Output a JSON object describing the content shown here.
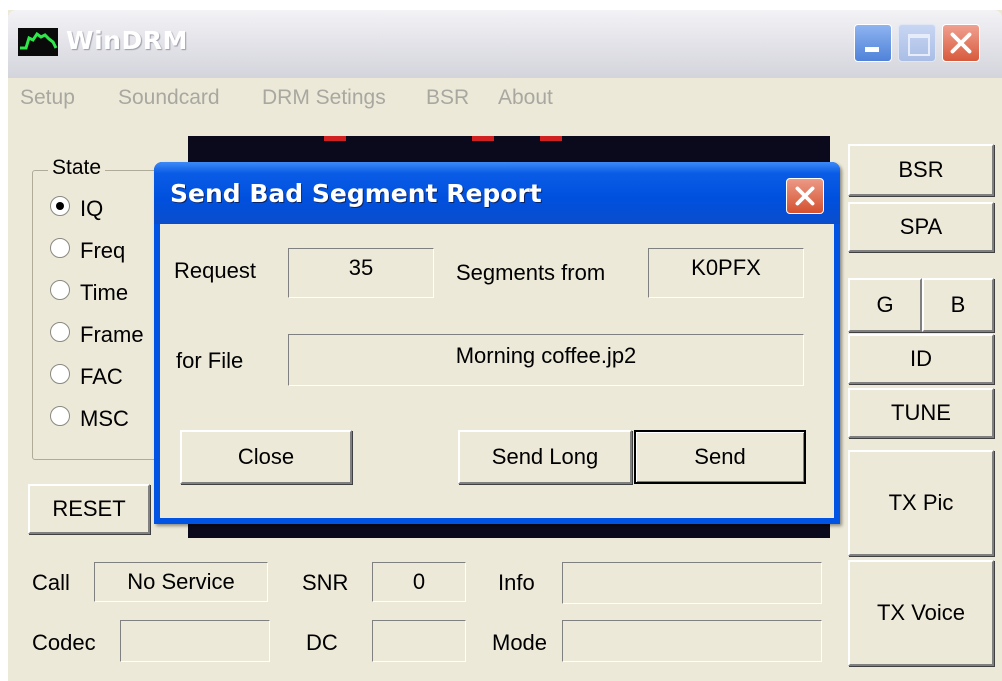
{
  "app": {
    "title": "WinDRM"
  },
  "menu": [
    "Setup",
    "Soundcard",
    "DRM Setings",
    "BSR",
    "About"
  ],
  "state": {
    "label": "State",
    "options": [
      "IQ",
      "Freq",
      "Time",
      "Frame",
      "FAC",
      "MSC"
    ],
    "selected": "IQ"
  },
  "buttons": {
    "reset": "RESET",
    "bsr": "BSR",
    "spa": "SPA",
    "g": "G",
    "b": "B",
    "id": "ID",
    "tune": "TUNE",
    "tx_pic": "TX Pic",
    "tx_voice": "TX Voice"
  },
  "status": {
    "call_label": "Call",
    "call_value": "No Service",
    "snr_label": "SNR",
    "snr_value": "0",
    "info_label": "Info",
    "info_value": "",
    "codec_label": "Codec",
    "codec_value": "",
    "dc_label": "DC",
    "dc_value": "",
    "mode_label": "Mode",
    "mode_value": ""
  },
  "dialog": {
    "title": "Send Bad Segment Report",
    "request_label": "Request",
    "request_value": "35",
    "segments_label": "Segments from",
    "segments_value": "K0PFX",
    "file_label": "for File",
    "file_value": "Morning coffee.jp2",
    "close_button": "Close",
    "send_long_button": "Send Long",
    "send_button": "Send"
  },
  "colors": {
    "window_bg": "#ece9d8",
    "dialog_title_blue": "#0050de",
    "display_bg": "#0a0a1c",
    "close_red": "#d4512f"
  }
}
